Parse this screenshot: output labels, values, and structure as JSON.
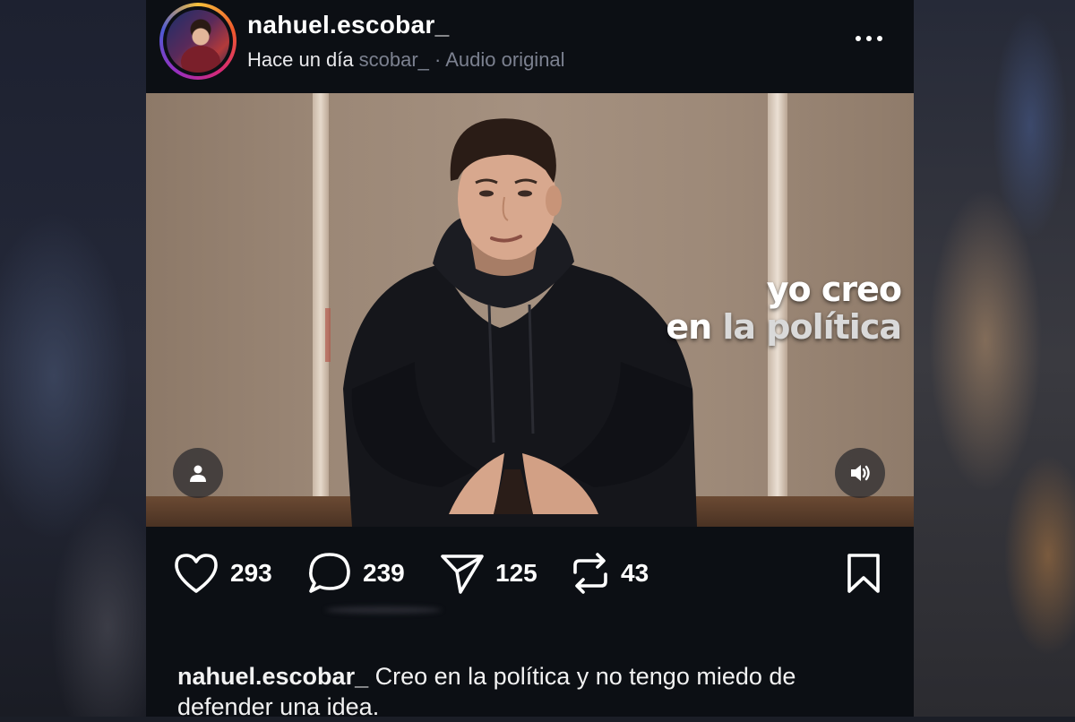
{
  "header": {
    "username": "nahuel.escobar_",
    "time_ago": "Hace un día",
    "audio_ghost": "scobar_ · Audio original"
  },
  "video": {
    "overlay_line1": "yo creo",
    "overlay_line2_a": "en",
    "overlay_line2_b": "la política"
  },
  "actions": {
    "likes": "293",
    "comments": "239",
    "shares": "125",
    "reposts": "43"
  },
  "caption": {
    "username": "nahuel.escobar_",
    "text": "Creo en la política y no tengo miedo de defender una idea."
  },
  "icons": {
    "more": "more-dots-icon",
    "user": "user-icon",
    "sound": "speaker-icon",
    "like": "heart-icon",
    "comment": "comment-bubble-icon",
    "share": "paper-plane-icon",
    "repost": "repost-icon",
    "save": "bookmark-icon"
  },
  "colors": {
    "background": "#0c0f14",
    "text": "#ffffff",
    "muted": "#7c8190"
  }
}
